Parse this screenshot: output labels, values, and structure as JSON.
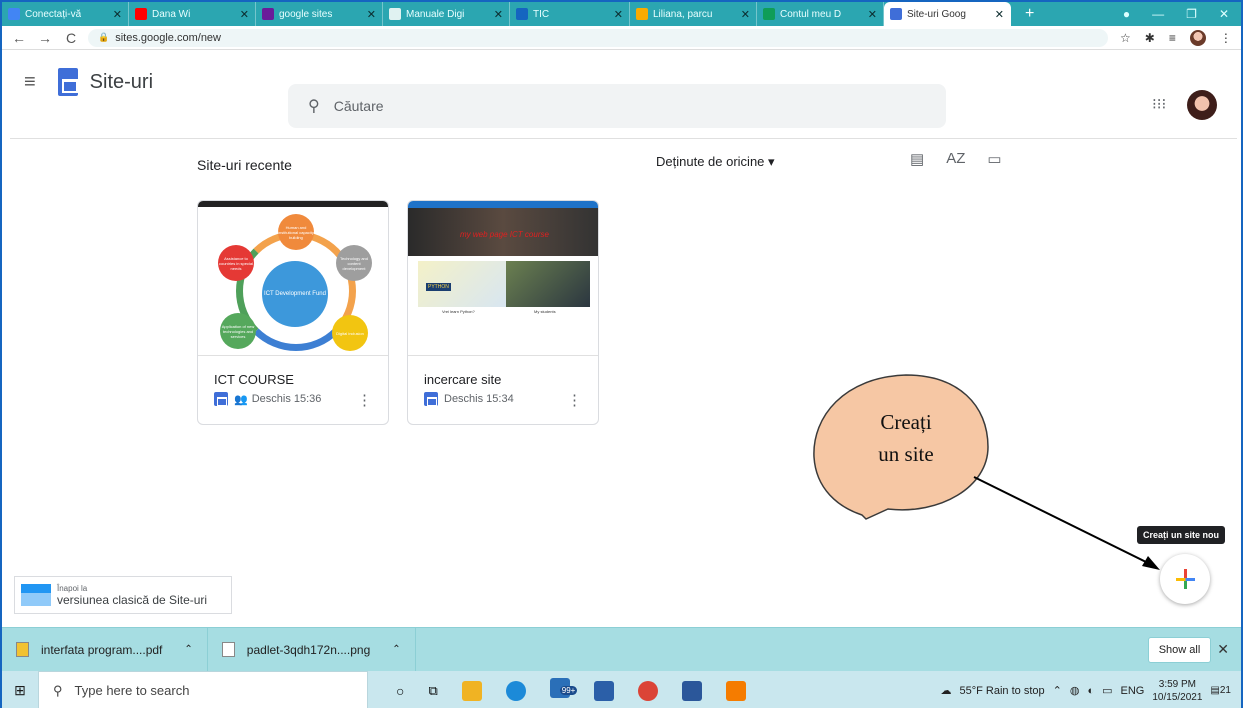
{
  "browser": {
    "tabs": [
      {
        "label": "Conectați-vă",
        "color": "#4285f4"
      },
      {
        "label": "Dana Wi",
        "color": "#ff0000"
      },
      {
        "label": "google sites",
        "color": "#6a1b9a"
      },
      {
        "label": "Manuale Digi",
        "color": "#e0f2f1"
      },
      {
        "label": "TIC",
        "color": "#1565c0"
      },
      {
        "label": "Liliana, parcu",
        "color": "#f9ab00"
      },
      {
        "label": "Contul meu D",
        "color": "#0f9d58"
      },
      {
        "label": "Site-uri Goog",
        "color": "#3f6ed8",
        "active": true
      }
    ],
    "new_tab": "+",
    "url": "sites.google.com/new"
  },
  "header": {
    "app_name": "Site-uri",
    "search_placeholder": "Căutare"
  },
  "main": {
    "section_title": "Site-uri recente",
    "owner_filter": "Deținute de oricine ▾",
    "sort_icon_label": "AZ",
    "sites": [
      {
        "title": "ICT COURSE",
        "meta": "Deschis 15:36",
        "shared": true
      },
      {
        "title": "incercare site",
        "meta": "Deschis 15:34",
        "shared": false
      }
    ],
    "thumb1": {
      "header": "ICT COURSE",
      "center": "ICT Development Fund",
      "nodes": [
        "Human and institutional capacity building",
        "Technology and content development",
        "Digital inclusion",
        "Application of new technologies and services",
        "Assistance to countries in special needs"
      ]
    },
    "thumb2": {
      "hero": "my web page ICT course",
      "caption1": "Vrei learn Python?",
      "caption2": "My students",
      "python": "PYTHON"
    }
  },
  "annotation": {
    "bubble_line1": "Creați",
    "bubble_line2": "un site"
  },
  "fab": {
    "tooltip": "Creați un site nou"
  },
  "classic": {
    "small": "Înapoi la",
    "big": "versiunea clasică de Site-uri"
  },
  "downloads": {
    "items": [
      "interfata program....pdf",
      "padlet-3qdh172n....png"
    ],
    "show_all": "Show all"
  },
  "taskbar": {
    "search_placeholder": "Type here to search",
    "badge": "99+",
    "weather": "55°F Rain to stop",
    "lang": "ENG",
    "time": "3:59 PM",
    "date": "10/15/2021",
    "notif": "21"
  }
}
